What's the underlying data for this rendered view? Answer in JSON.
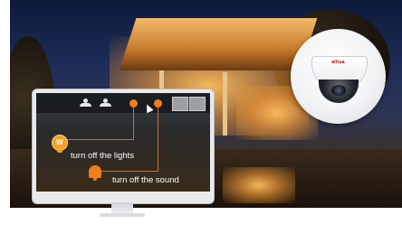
{
  "scene": {
    "camera_brand": "alhua"
  },
  "monitor": {
    "toolbar_icons": [
      "user-icon",
      "user-icon",
      "orange-alert-icon",
      "cursor-icon",
      "orange-alert-icon",
      "camera-thumb-icon",
      "camera-thumb-icon"
    ],
    "annotations": {
      "lights_label": "turn off the lights",
      "sound_label": "turn off the sound",
      "bulb_icon_letter": "W"
    }
  },
  "colors": {
    "accent_orange": "#f07d1e",
    "bulb_yellow": "#f4a023",
    "label_text": "#ffffff"
  }
}
